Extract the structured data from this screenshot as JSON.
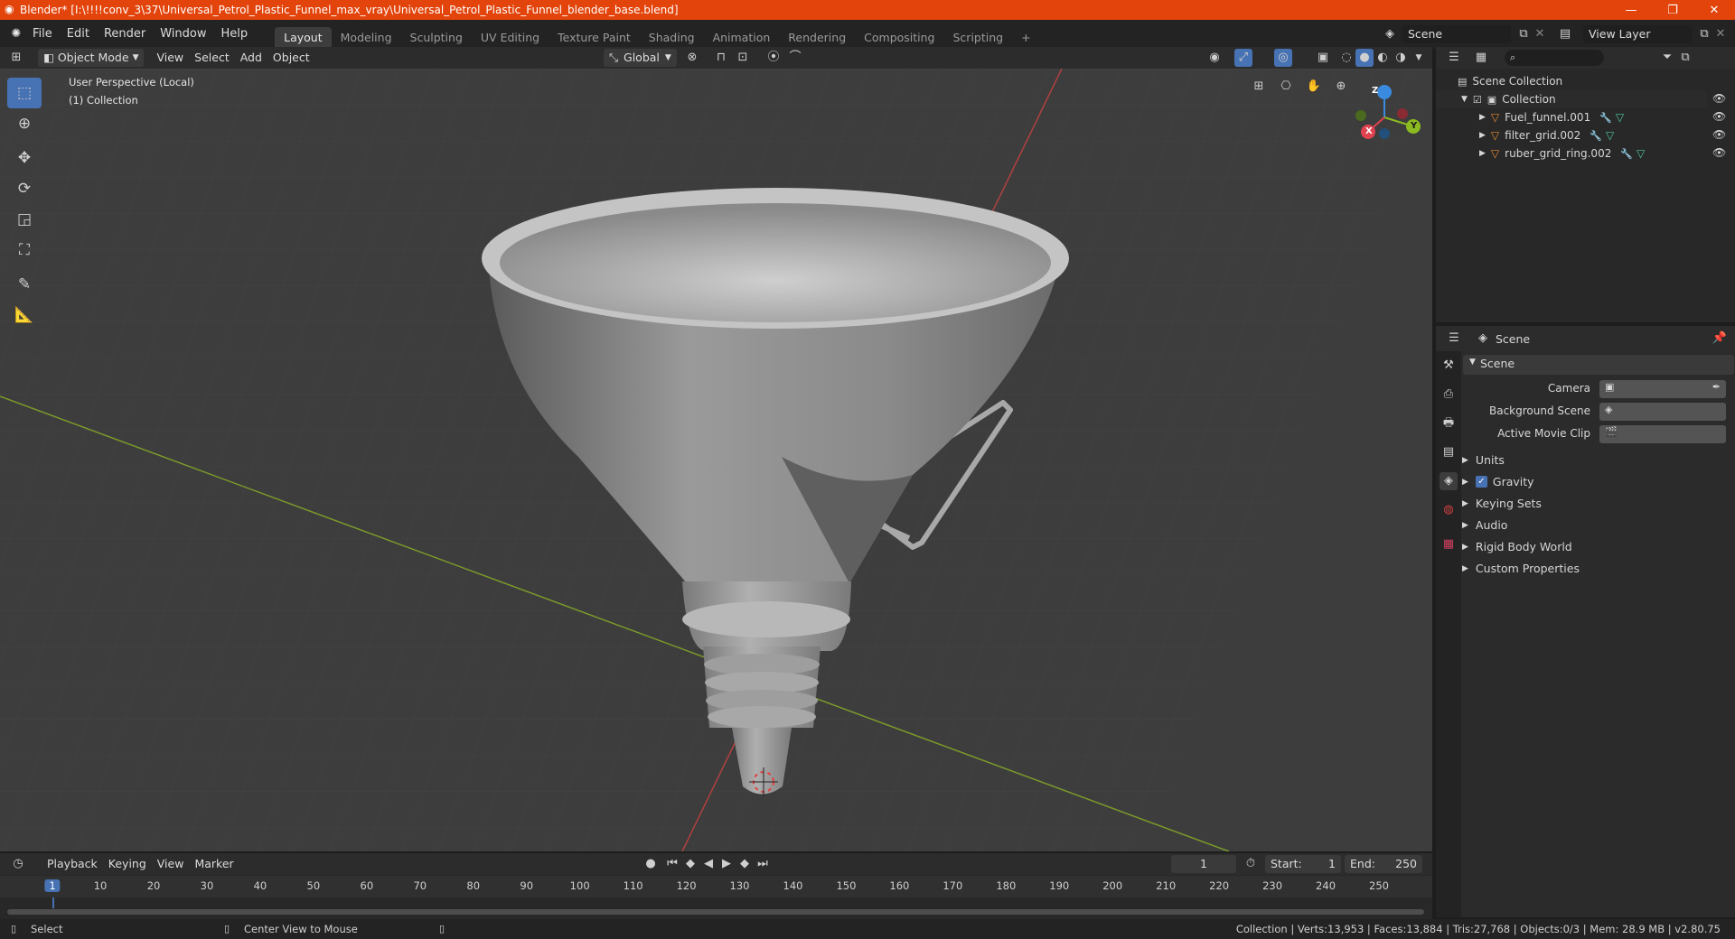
{
  "window": {
    "title": "Blender* [I:\\!!!!conv_3\\37\\Universal_Petrol_Plastic_Funnel_max_vray\\Universal_Petrol_Plastic_Funnel_blender_base.blend]",
    "minimize": "—",
    "maximize": "❐",
    "close": "✕"
  },
  "menu": [
    "File",
    "Edit",
    "Render",
    "Window",
    "Help"
  ],
  "workspaces": [
    "Layout",
    "Modeling",
    "Sculpting",
    "UV Editing",
    "Texture Paint",
    "Shading",
    "Animation",
    "Rendering",
    "Compositing",
    "Scripting"
  ],
  "workspace_add": "+",
  "scene_selector": {
    "value": "Scene"
  },
  "view_layer": {
    "value": "View Layer"
  },
  "viewport_header": {
    "mode": "Object Mode",
    "menus": [
      "View",
      "Select",
      "Add",
      "Object"
    ],
    "orientation": "Global"
  },
  "viewport": {
    "perspective": "User Perspective (Local)",
    "collection": "(1) Collection"
  },
  "gizmo": {
    "x": "X",
    "y": "Y",
    "z": "Z"
  },
  "outliner": {
    "root": "Scene Collection",
    "collection": "Collection",
    "objects": [
      {
        "name": "Fuel_funnel.001"
      },
      {
        "name": "filter_grid.002"
      },
      {
        "name": "ruber_grid_ring.002"
      }
    ]
  },
  "properties": {
    "header": "Scene",
    "panel": "Scene",
    "camera_label": "Camera",
    "background_scene_label": "Background Scene",
    "active_clip_label": "Active Movie Clip",
    "sections": [
      {
        "label": "Units"
      },
      {
        "label": "Gravity"
      },
      {
        "label": "Keying Sets"
      },
      {
        "label": "Audio"
      },
      {
        "label": "Rigid Body World"
      },
      {
        "label": "Custom Properties"
      }
    ]
  },
  "timeline": {
    "menus": [
      "Playback",
      "Keying",
      "View",
      "Marker"
    ],
    "current_frame": "1",
    "start_label": "Start:",
    "start": "1",
    "end_label": "End:",
    "end": "250",
    "ruler": [
      1,
      10,
      20,
      30,
      40,
      50,
      60,
      70,
      80,
      90,
      100,
      110,
      120,
      130,
      140,
      150,
      160,
      170,
      180,
      190,
      200,
      210,
      220,
      230,
      240,
      250
    ]
  },
  "statusbar": {
    "select": "Select",
    "center_view": "Center View to Mouse",
    "stats": "Collection | Verts:13,953 | Faces:13,884 | Tris:27,768 | Objects:0/3 | Mem: 28.9 MB | v2.80.75"
  },
  "colors": {
    "titlebar": "#e2440b",
    "accent": "#4772b3",
    "x_axis": "#e0424f",
    "y_axis": "#8cbb21",
    "z_axis": "#3a8be0",
    "mesh_icon": "#e68a2e"
  }
}
